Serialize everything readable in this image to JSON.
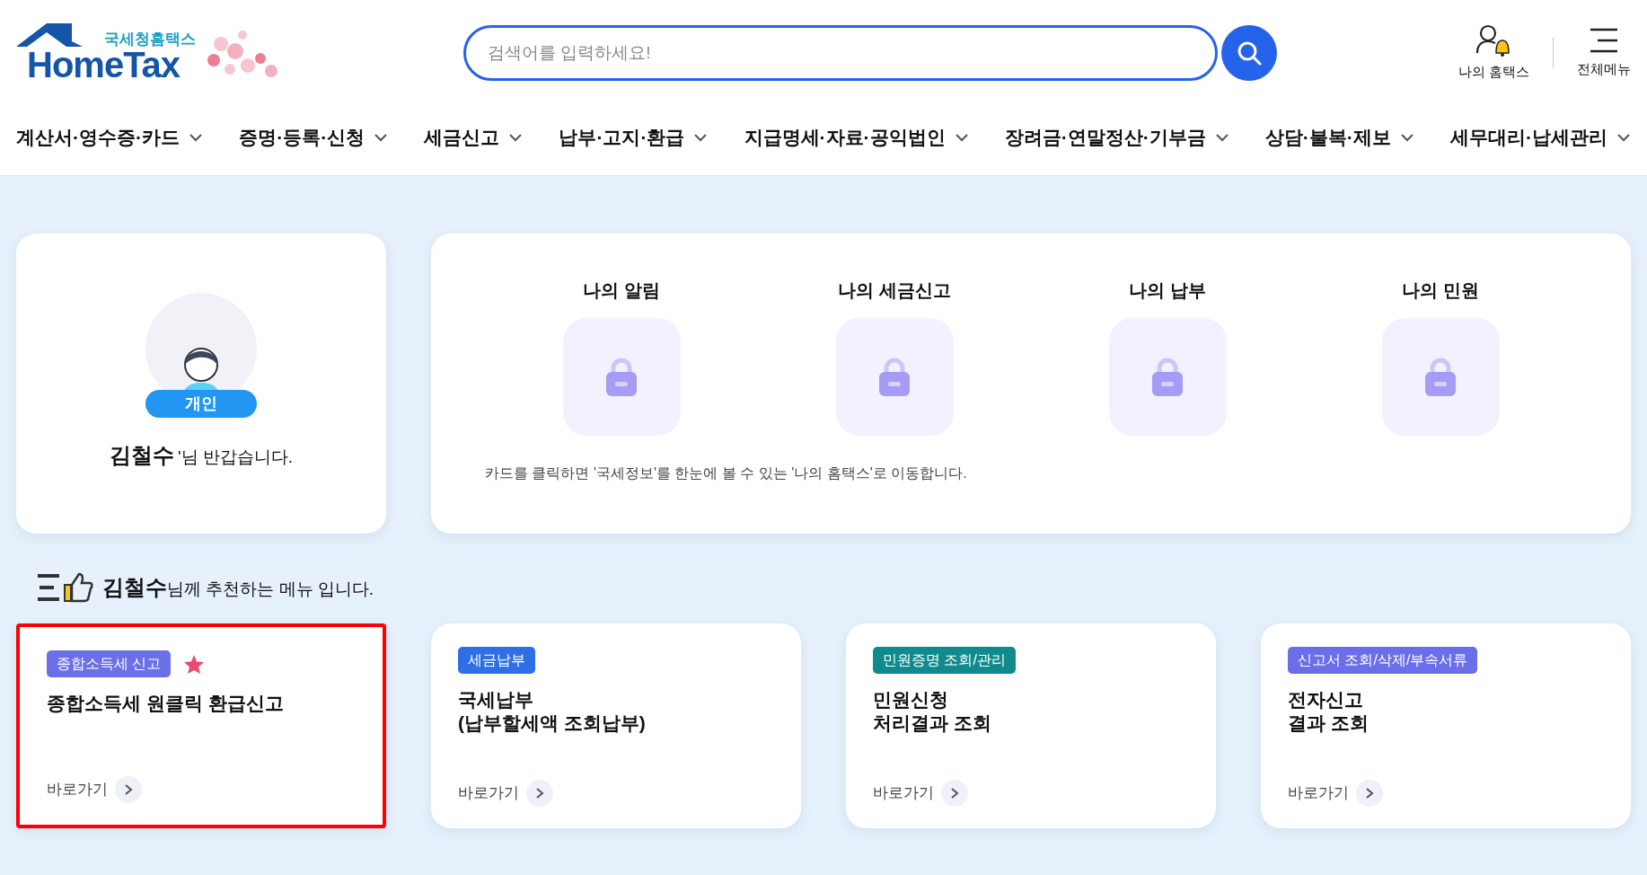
{
  "header": {
    "logo": {
      "subtitle": "국세청홈택스",
      "title": "HomeTax"
    },
    "search": {
      "placeholder": "검색어를 입력하세요!"
    },
    "utilities": [
      {
        "kind": "profile",
        "label": "나의 홈택스"
      },
      {
        "kind": "menu",
        "label": "전체메뉴"
      }
    ]
  },
  "nav": [
    {
      "label": "계산서·영수증·카드"
    },
    {
      "label": "증명·등록·신청"
    },
    {
      "label": "세금신고"
    },
    {
      "label": "납부·고지·환급"
    },
    {
      "label": "지급명세·자료·공익법인"
    },
    {
      "label": "장려금·연말정산·기부금"
    },
    {
      "label": "상담·불복·제보"
    },
    {
      "label": "세무대리·납세관리"
    }
  ],
  "profile": {
    "badge": "개인",
    "name": "김철수",
    "greeting": "'님 반갑습니다."
  },
  "my_hometax": {
    "items": [
      {
        "label": "나의 알림",
        "locked": true
      },
      {
        "label": "나의 세금신고",
        "locked": true
      },
      {
        "label": "나의 납부",
        "locked": true
      },
      {
        "label": "나의 민원",
        "locked": true
      }
    ],
    "note": "카드를 클릭하면 '국세정보'를 한눈에 볼 수 있는 '나의 홈택스'로 이동합니다."
  },
  "recommend": {
    "name": "김철수",
    "text": "님께 추천하는 메뉴 입니다.",
    "cards": [
      {
        "tag": "종합소득세 신고",
        "color": "#6b6fe8",
        "favorite": true,
        "highlighted": true,
        "title": "종합소득세 원클릭 환급신고",
        "link": "바로가기"
      },
      {
        "tag": "세금납부",
        "color": "#2f6fe6",
        "favorite": false,
        "highlighted": false,
        "title": "국세납부\n(납부할세액 조회납부)",
        "link": "바로가기"
      },
      {
        "tag": "민원증명 조회/관리",
        "color": "#0f8b8d",
        "favorite": false,
        "highlighted": false,
        "title": "민원신청\n처리결과 조회",
        "link": "바로가기"
      },
      {
        "tag": "신고서 조회/삭제/부속서류",
        "color": "#6b6ee9",
        "favorite": false,
        "highlighted": false,
        "title": "전자신고\n결과 조회",
        "link": "바로가기"
      }
    ]
  }
}
